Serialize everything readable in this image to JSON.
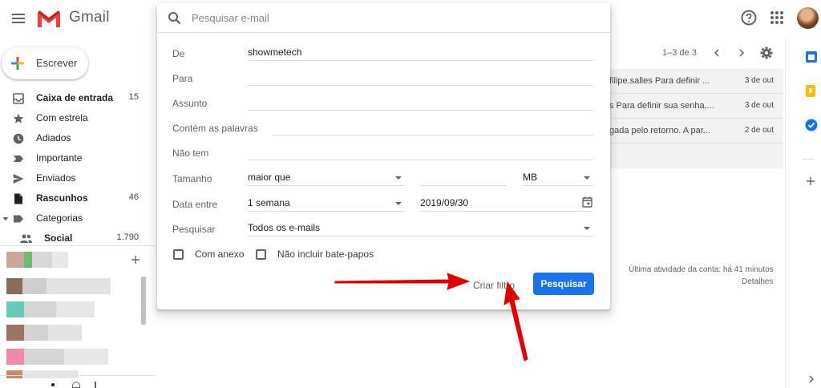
{
  "app": {
    "brand": "Gmail"
  },
  "colors": {
    "primary": "#1a73e8",
    "arrow": "#e00000",
    "gmail_red": "#ea4335"
  },
  "compose": {
    "label": "Escrever"
  },
  "nav": [
    {
      "id": "inbox",
      "label": "Caixa de entrada",
      "count": "15",
      "bold": true,
      "icon": "inbox-icon"
    },
    {
      "id": "starred",
      "label": "Com estrela",
      "count": "",
      "bold": false,
      "icon": "star-icon"
    },
    {
      "id": "snoozed",
      "label": "Adiados",
      "count": "",
      "bold": false,
      "icon": "clock-icon"
    },
    {
      "id": "important",
      "label": "Importante",
      "count": "",
      "bold": false,
      "icon": "important-icon"
    },
    {
      "id": "sent",
      "label": "Enviados",
      "count": "",
      "bold": false,
      "icon": "send-icon"
    },
    {
      "id": "drafts",
      "label": "Rascunhos",
      "count": "46",
      "bold": true,
      "icon": "draft-icon"
    },
    {
      "id": "categories",
      "label": "Categorias",
      "count": "",
      "bold": false,
      "icon": "label-icon"
    },
    {
      "id": "social",
      "label": "Social",
      "count": "1.790",
      "bold": true,
      "icon": "people-icon"
    }
  ],
  "search": {
    "placeholder": "Pesquisar e-mail",
    "fields": {
      "from": {
        "label": "De",
        "value": "showmetech"
      },
      "to": {
        "label": "Para",
        "value": ""
      },
      "subject": {
        "label": "Assunto",
        "value": ""
      },
      "has_words": {
        "label": "Contém as palavras",
        "value": ""
      },
      "doesnt_have": {
        "label": "Não tem",
        "value": ""
      },
      "size": {
        "label": "Tamanho",
        "operator": "maior que",
        "value": "",
        "unit": "MB"
      },
      "date": {
        "label": "Data entre",
        "range": "1 semana",
        "value": "2019/09/30"
      },
      "search_in": {
        "label": "Pesquisar",
        "value": "Todos os e-mails"
      }
    },
    "checkboxes": {
      "has_attachment": "Com anexo",
      "exclude_chats": "Não incluir bate-papos"
    },
    "buttons": {
      "create_filter": "Criar filtro",
      "search": "Pesquisar"
    }
  },
  "list": {
    "pagination": "1–3 de 3",
    "rows": [
      {
        "snippet": "filipe.salles Para definir ...",
        "date": "3 de out"
      },
      {
        "snippet": "s Para definir sua senha,...",
        "date": "3 de out"
      },
      {
        "snippet": "gada pelo retorno. A par...",
        "date": "2 de out"
      }
    ]
  },
  "footer": {
    "activity": "Última atividade da conta: há 41 minutos",
    "details": "Detalhes"
  }
}
